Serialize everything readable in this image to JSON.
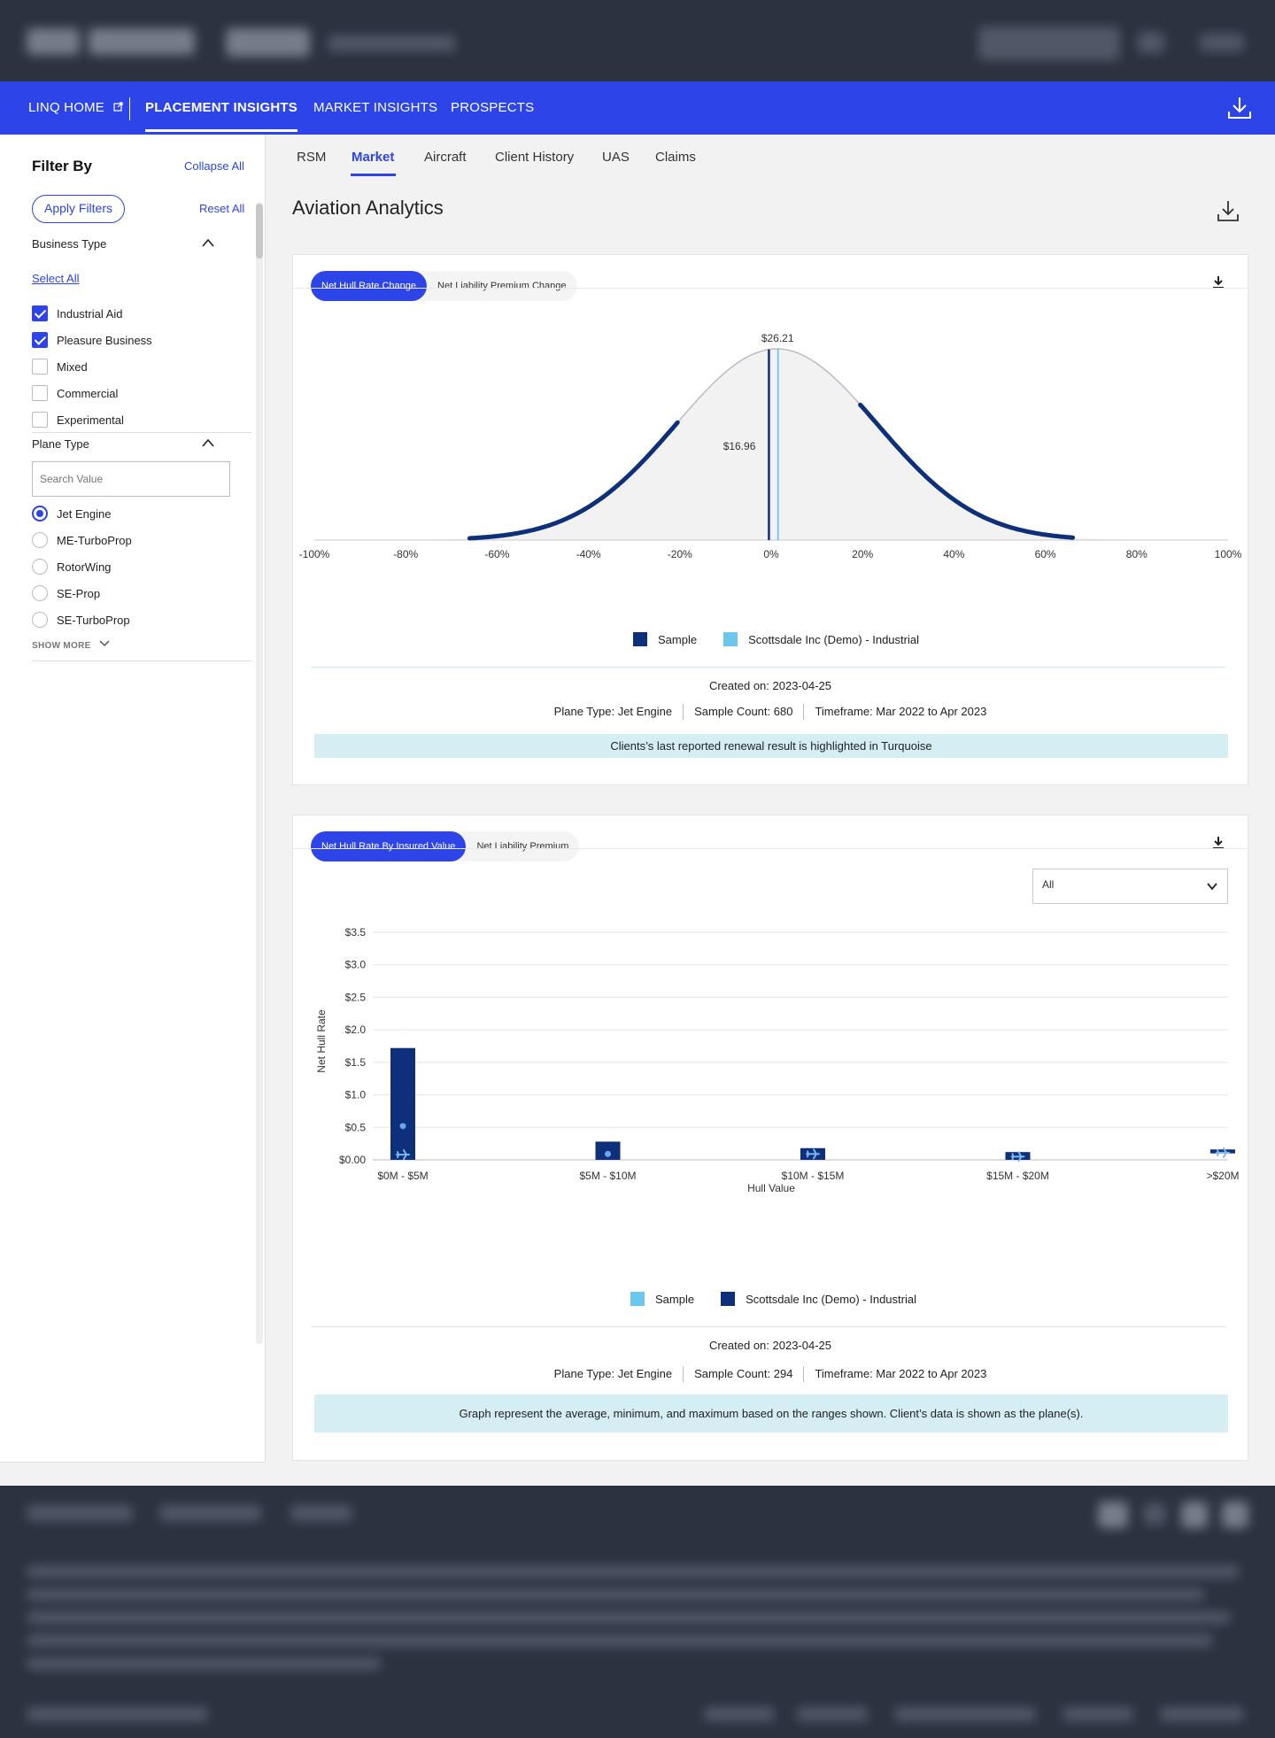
{
  "colors": {
    "brand_blue": "#2d45e8",
    "navy": "#0e2f7a",
    "turquoise": "#6cc7ee",
    "note_bg": "#d5eef3"
  },
  "nav": {
    "items": [
      {
        "label": "LINQ HOME",
        "external": true
      },
      {
        "label": "PLACEMENT INSIGHTS",
        "active": true
      },
      {
        "label": "MARKET INSIGHTS"
      },
      {
        "label": "PROSPECTS"
      }
    ],
    "download_icon": "download-icon"
  },
  "sidebar": {
    "title": "Filter By",
    "collapse_all": "Collapse All",
    "apply_filters": "Apply Filters",
    "reset_all": "Reset All",
    "business_type": {
      "label": "Business Type",
      "select_all": "Select All",
      "options": [
        {
          "label": "Industrial Aid",
          "checked": true
        },
        {
          "label": "Pleasure Business",
          "checked": true
        },
        {
          "label": "Mixed",
          "checked": false
        },
        {
          "label": "Commercial",
          "checked": false
        },
        {
          "label": "Experimental",
          "checked": false
        }
      ]
    },
    "plane_type": {
      "label": "Plane Type",
      "search_placeholder": "Search Value",
      "options": [
        {
          "label": "Jet Engine",
          "selected": true
        },
        {
          "label": "ME-TurboProp",
          "selected": false
        },
        {
          "label": "RotorWing",
          "selected": false
        },
        {
          "label": "SE-Prop",
          "selected": false
        },
        {
          "label": "SE-TurboProp",
          "selected": false
        }
      ],
      "show_more": "SHOW MORE"
    }
  },
  "tabs": [
    {
      "label": "RSM"
    },
    {
      "label": "Market",
      "active": true
    },
    {
      "label": "Aircraft"
    },
    {
      "label": "Client History"
    },
    {
      "label": "UAS"
    },
    {
      "label": "Claims"
    }
  ],
  "page_title": "Aviation Analytics",
  "card1": {
    "pills": [
      "Net Hull Rate Change",
      "Net Liability Premium Change"
    ],
    "active_pill": 0,
    "legend": [
      "Sample",
      "Scottsdale Inc (Demo) - Industrial"
    ],
    "created": "Created on: 2023-04-25",
    "meta": [
      "Plane Type: Jet Engine",
      "Sample Count: 680",
      "Timeframe: Mar 2022 to Apr 2023"
    ],
    "note": "Clients’s last reported renewal result is highlighted in Turquoise"
  },
  "card2": {
    "pills": [
      "Net Hull Rate By Insured Value",
      "Net Liability Premium"
    ],
    "active_pill": 0,
    "dropdown_value": "All",
    "legend": [
      "Sample",
      "Scottsdale Inc (Demo) - Industrial"
    ],
    "created": "Created on: 2023-04-25",
    "meta": [
      "Plane Type: Jet Engine",
      "Sample Count: 294",
      "Timeframe: Mar 2022 to Apr 2023"
    ],
    "note": "Graph represent the average, minimum, and maximum based on the ranges shown.  Client’s data is shown as the plane(s)."
  },
  "chart_data": [
    {
      "type": "area",
      "title": "",
      "xlabel": "",
      "ylabel": "",
      "x_ticks": [
        "-100%",
        "-80%",
        "-60%",
        "-40%",
        "-20%",
        "0%",
        "20%",
        "40%",
        "60%",
        "80%",
        "100%"
      ],
      "xlim": [
        -100,
        100
      ],
      "distribution": {
        "mean": 1.2,
        "sd": 22
      },
      "highlight_range": [
        -66,
        66
      ],
      "markers": [
        {
          "series": "Sample",
          "x": -0.5,
          "label": "$16.96"
        },
        {
          "series": "Scottsdale Inc (Demo) - Industrial",
          "x": 1.2,
          "label": "$26.21"
        }
      ],
      "series": [
        {
          "name": "Sample",
          "color": "#0e2f7a"
        },
        {
          "name": "Scottsdale Inc (Demo) - Industrial",
          "color": "#6cc7ee"
        }
      ],
      "legend_position": "bottom"
    },
    {
      "type": "bar",
      "title": "",
      "xlabel": "Hull Value",
      "ylabel": "Net Hull Rate",
      "categories": [
        "$0M - $5M",
        "$5M - $10M",
        "$10M - $15M",
        "$15M - $20M",
        ">$20M"
      ],
      "y_ticks": [
        "$0.00",
        "$0.5",
        "$1.0",
        "$1.5",
        "$2.0",
        "$2.5",
        "$3.0",
        "$3.5"
      ],
      "ylim": [
        0,
        3.5
      ],
      "series": [
        {
          "name": "Sample range",
          "type": "range",
          "color": "#0e2f7a",
          "min": [
            0.0,
            0.0,
            0.0,
            0.0,
            0.1
          ],
          "max": [
            1.72,
            0.28,
            0.18,
            0.12,
            0.16
          ],
          "avg": [
            0.52,
            0.09,
            null,
            null,
            null
          ]
        },
        {
          "name": "Scottsdale Inc (Demo) - Industrial",
          "type": "plane",
          "values": [
            0.08,
            null,
            0.09,
            0.05,
            0.11
          ]
        }
      ],
      "legend": [
        "Sample",
        "Scottsdale Inc (Demo) - Industrial"
      ],
      "legend_position": "bottom",
      "grid": true
    }
  ]
}
